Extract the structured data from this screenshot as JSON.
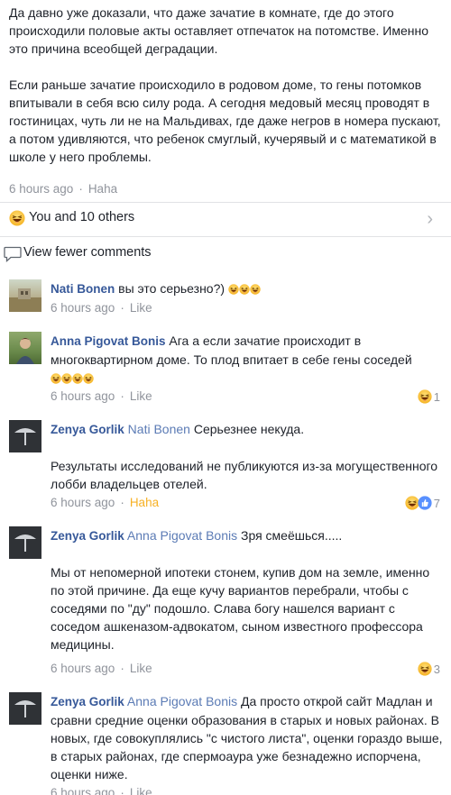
{
  "post": {
    "paragraph_1": "Да давно уже доказали, что даже зачатие в комнате, где до этого происходили половые акты оставляет отпечаток на потомстве. Именно это причина всеобщей деградации.",
    "paragraph_2": "Если раньше зачатие происходило в родовом доме, то гены потомков впитывали в себя всю силу рода. А сегодня медовый месяц проводят в гостиницах, чуть ли не на Мальдивах, где даже негров в номера пускают, а потом удивляются, что ребенок смуглый, кучерявый и с математикой в школе у него проблемы.",
    "time": "6 hours ago",
    "reaction_label": "Haha"
  },
  "reactions": {
    "summary": "You and 10 others",
    "icon": "haha-emoji-icon"
  },
  "view_fewer": {
    "label": "View fewer comments",
    "icon": "comment-bubble-icon"
  },
  "comments": [
    {
      "author": "Nati Bonen",
      "mention": "",
      "text": "вы это серьезно?)",
      "text_emojis": "😂😂😂",
      "para2": "",
      "time": "6 hours ago",
      "action": "Like",
      "reaction_count": ""
    },
    {
      "author": "Anna Pigovat Bonis",
      "mention": "",
      "text": "Ага а если зачатие происходит в многоквартирном доме. То плод впитает в себе гены соседей",
      "text_emojis": "😂😂😂😂",
      "para2": "",
      "time": "6 hours ago",
      "action": "Like",
      "reaction_count": "1"
    },
    {
      "author": "Zenya Gorlik",
      "mention": "Nati Bonen",
      "text": "Серьезнее некуда.",
      "text_emojis": "",
      "para2": "Результаты исследований не публикуются из-за могущественного лобби владельцев отелей.",
      "time": "6 hours ago",
      "action": "Haha",
      "reaction_count": "7"
    },
    {
      "author": "Zenya Gorlik",
      "mention": "Anna Pigovat Bonis",
      "text": "Зря смеёшься.....",
      "text_emojis": "",
      "para2": "Мы от непомерной ипотеки стонем, купив дом на земле, именно по этой причине. Да еще кучу вариантов перебрали, чтобы с соседями по \"ду\" подошло. Слава богу нашелся вариант с соседом ашкеназом-адвокатом, сыном известного профессора медицины.",
      "time": "6 hours ago",
      "action": "Like",
      "reaction_count": "3"
    },
    {
      "author": "Zenya Gorlik",
      "mention": "Anna Pigovat Bonis",
      "text": "Да просто открой сайт Мадлан и сравни средние оценки образования в старых и новых районах. В новых, где совокуплялись \"с чистого листа\", оценки гораздо выше, в старых районах, где спермоаура уже безнадежно испорчена, оценки ниже.",
      "text_emojis": "",
      "para2": "",
      "time": "6 hours ago",
      "action": "Like",
      "reaction_count": ""
    }
  ],
  "colors": {
    "link": "#365899",
    "meta": "#90949c",
    "haha": "#f7b125",
    "like_blue": "#5890ff"
  }
}
